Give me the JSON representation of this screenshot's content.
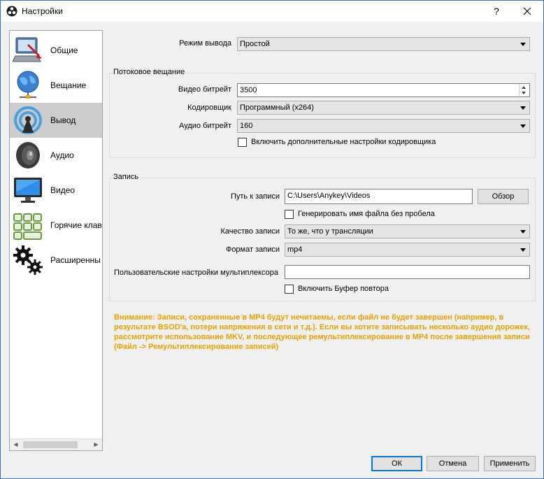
{
  "window": {
    "title": "Настройки",
    "help_label": "?",
    "colors": {
      "accent": "#0078d7",
      "warning": "#e5a100",
      "active_item": "#cccccc"
    }
  },
  "sidebar": {
    "items": [
      {
        "label": "Общие",
        "icon": "computer-icon"
      },
      {
        "label": "Вещание",
        "icon": "globe-icon"
      },
      {
        "label": "Вывод",
        "icon": "broadcast-icon",
        "active": true
      },
      {
        "label": "Аудио",
        "icon": "speaker-icon"
      },
      {
        "label": "Видео",
        "icon": "monitor-icon"
      },
      {
        "label": "Горячие клав",
        "icon": "keyboard-icon"
      },
      {
        "label": "Расширенны",
        "icon": "gears-icon"
      }
    ]
  },
  "output": {
    "mode_label": "Режим вывода",
    "mode_value": "Простой"
  },
  "streaming": {
    "title": "Потоковое вещание",
    "video_bitrate_label": "Видео битрейт",
    "video_bitrate_value": "3500",
    "encoder_label": "Кодировщик",
    "encoder_value": "Программный (x264)",
    "audio_bitrate_label": "Аудио битрейт",
    "audio_bitrate_value": "160",
    "advanced_encoder_label": "Включить дополнительные настройки кодировщика"
  },
  "recording": {
    "title": "Запись",
    "path_label": "Путь к записи",
    "path_value": "C:\\Users\\Anykey\\Videos",
    "browse_label": "Обзор",
    "no_space_label": "Генерировать имя файла без пробела",
    "quality_label": "Качество записи",
    "quality_value": "То же, что у трансляции",
    "format_label": "Формат записи",
    "format_value": "mp4",
    "muxer_label": "Пользовательские настройки мультиплексора",
    "muxer_value": "",
    "replay_buffer_label": "Включить Буфер повтора"
  },
  "warning_text": "Внимание: Записи, сохраненные в MP4 будут нечитаемы, если файл не будет завершен (например, в результате BSOD'a, потери напряжения в сети и т.д.). Если вы хотите записывать несколько аудио дорожек, рассмотрите использование MKV, и последующее ремультиплексирование в MP4 после завершения записи (Файл -> Ремультиплексирование записей)",
  "footer": {
    "ok_label": "ОК",
    "cancel_label": "Отмена",
    "apply_label": "Применить"
  }
}
